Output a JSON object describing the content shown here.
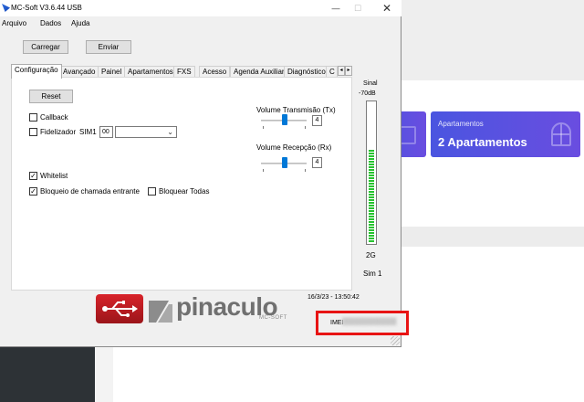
{
  "background": {
    "cards": [
      {
        "label": "",
        "value": ""
      },
      {
        "label": "Apartamentos",
        "value": "2 Apartamentos"
      }
    ]
  },
  "window": {
    "title": "MC-Soft V3.6.44 USB",
    "controls": {
      "minimize": "—",
      "maximize": "☐",
      "close": "✕"
    }
  },
  "menu": [
    "Arquivo",
    "Dados",
    "Ajuda"
  ],
  "toolbar": {
    "load_label": "Carregar",
    "send_label": "Enviar"
  },
  "tabs": {
    "items": [
      "Configuração",
      "Avançado",
      "Painel",
      "Apartamentos",
      "FXS",
      "Acesso",
      "Agenda Auxiliar",
      "Diagnóstico",
      "C"
    ],
    "active": "Configuração",
    "scroll_left": "◂",
    "scroll_right": "▸"
  },
  "config": {
    "reset_label": "Reset",
    "callback_label": "Callback",
    "callback_checked": false,
    "fidelizador_label": "Fidelizador",
    "fidelizador_checked": false,
    "sim_label": "SIM1",
    "sim_value": "00",
    "dropdown_value": "",
    "whitelist_label": "Whitelist",
    "whitelist_checked": true,
    "bloqueio_label": "Bloqueio de chamada entrante",
    "bloqueio_checked": true,
    "bloquear_todas_label": "Bloquear Todas",
    "bloquear_todas_checked": false,
    "vol_tx_label": "Volume Transmisão (Tx)",
    "vol_tx_value": "4",
    "vol_tx_fraction": 0.5,
    "vol_rx_label": "Volume Recepção (Rx)",
    "vol_rx_value": "4",
    "vol_rx_fraction": 0.5
  },
  "signal": {
    "title": "Sinal",
    "db": "-70dB",
    "network": "2G",
    "sim": "Sim 1",
    "level_fraction": 0.66,
    "color": "#26c32f"
  },
  "footer": {
    "date": "16/3/23 - 13:50:42",
    "imei_label": "IMEI",
    "imei_value": "████████████",
    "brand": "pinaculo",
    "brand_sub": "MC-SOFT"
  },
  "colors": {
    "highlight": "#e81414",
    "accent": "#0078d7",
    "logo_red": "#d8232a"
  }
}
